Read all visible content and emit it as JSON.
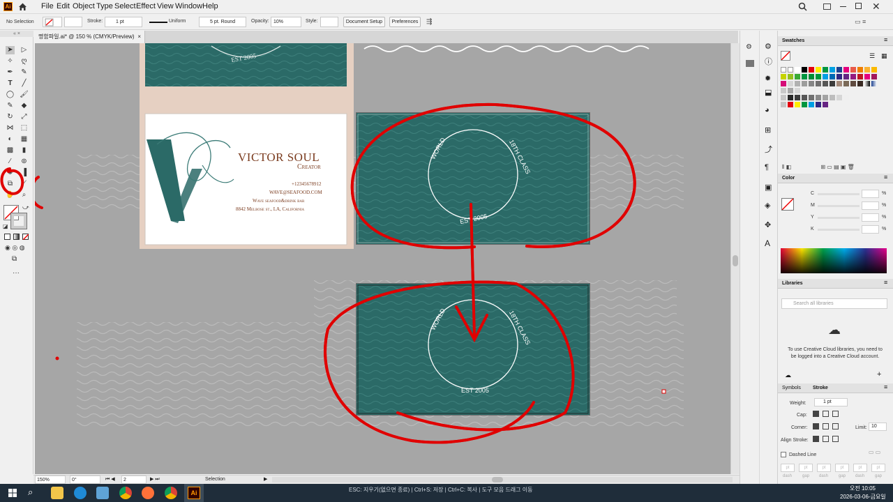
{
  "app": {
    "logo": "Ai",
    "accent": "#ff9a00"
  },
  "menu": [
    "File",
    "Edit",
    "Object",
    "Type",
    "Select",
    "Effect",
    "View",
    "Window",
    "Help"
  ],
  "control": {
    "selection": "No Selection",
    "stroke_label": "Stroke:",
    "stroke_value": "1 pt",
    "profile": "Uniform",
    "brush": "5 pt. Round",
    "opacity_label": "Opacity:",
    "opacity_value": "10%",
    "style_label": "Style:",
    "document_setup": "Document Setup",
    "preferences": "Preferences"
  },
  "document": {
    "tab_title": "명함파일.ai* @ 150 % (CMYK/Preview)",
    "close": "×"
  },
  "status": {
    "zoom": "150%",
    "rotation": "0°",
    "artboard": "2",
    "tool": "Selection",
    "hint": "ESC: 지우기(없으면 종료) | Ctrl+S: 저장 | Ctrl+C: 복사 | 도구 모음 드래그 이동"
  },
  "card": {
    "name": "VICTOR SOUL",
    "title": "Creator",
    "phone": "+12345678912",
    "email": "wave@seafood.com",
    "company": "Wave seafood&drink bar",
    "address": "8842 Melbose st., LA, California",
    "badge_left": "WORLD",
    "badge_right": "18TH CLASS",
    "badge_bottom": "EST 2005",
    "teal": "#2b6a67"
  },
  "panels": {
    "swatches": "Swatches",
    "color": "Color",
    "color_channels": [
      "C",
      "M",
      "Y",
      "K"
    ],
    "percent": "%",
    "libraries": "Libraries",
    "lib_search": "Search all libraries",
    "lib_message": "To use Creative Cloud libraries, you need to be logged into a Creative Cloud account.",
    "symbols": "Symbols",
    "stroke": "Stroke",
    "weight_label": "Weight:",
    "weight_value": "1 pt",
    "cap_label": "Cap:",
    "corner_label": "Corner:",
    "limit_label": "Limit:",
    "limit_value": "10",
    "align_label": "Align Stroke:",
    "dashed": "Dashed Line",
    "dash_cells": [
      "pt",
      "pt",
      "pt",
      "pt",
      "pt",
      "pt"
    ],
    "dash_labels": [
      "dash",
      "gap",
      "dash",
      "gap",
      "dash",
      "gap"
    ]
  },
  "taskbar": {
    "time": "오전 10:05",
    "date": "2026-03-06-금요일"
  },
  "annotation_color": "#e00000"
}
